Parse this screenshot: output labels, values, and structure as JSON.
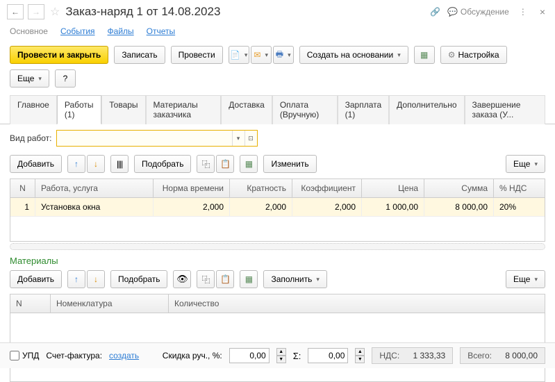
{
  "header": {
    "title": "Заказ-наряд 1 от 14.08.2023",
    "discuss": "Обсуждение"
  },
  "subnav": {
    "main": "Основное",
    "events": "События",
    "files": "Файлы",
    "reports": "Отчеты"
  },
  "toolbar": {
    "post_close": "Провести и закрыть",
    "save": "Записать",
    "post": "Провести",
    "create_based": "Создать на основании",
    "settings": "Настройка",
    "more": "Еще",
    "help": "?"
  },
  "tabs": [
    {
      "label": "Главное"
    },
    {
      "label": "Работы (1)"
    },
    {
      "label": "Товары"
    },
    {
      "label": "Материалы заказчика"
    },
    {
      "label": "Доставка"
    },
    {
      "label": "Оплата (Вручную)"
    },
    {
      "label": "Зарплата (1)"
    },
    {
      "label": "Дополнительно"
    },
    {
      "label": "Завершение заказа (У..."
    }
  ],
  "field": {
    "vid_rabot_label": "Вид работ:"
  },
  "tbl_toolbar": {
    "add": "Добавить",
    "pick": "Подобрать",
    "change": "Изменить",
    "fill": "Заполнить",
    "more": "Еще"
  },
  "works": {
    "headers": {
      "n": "N",
      "service": "Работа, услуга",
      "norm": "Норма времени",
      "krat": "Кратность",
      "koef": "Коэффициент",
      "price": "Цена",
      "sum": "Сумма",
      "nds": "% НДС"
    },
    "rows": [
      {
        "n": "1",
        "service": "Установка окна",
        "norm": "2,000",
        "krat": "2,000",
        "koef": "2,000",
        "price": "1 000,00",
        "sum": "8 000,00",
        "nds": "20%"
      }
    ]
  },
  "materials": {
    "title": "Материалы",
    "headers": {
      "n": "N",
      "nom": "Номенклатура",
      "qty": "Количество"
    }
  },
  "footer": {
    "upd": "УПД",
    "invoice_label": "Счет-фактура:",
    "invoice_link": "создать",
    "discount_label": "Скидка руч., %:",
    "discount_val": "0,00",
    "sigma_val": "0,00",
    "nds_label": "НДС:",
    "nds_val": "1 333,33",
    "total_label": "Всего:",
    "total_val": "8 000,00"
  }
}
